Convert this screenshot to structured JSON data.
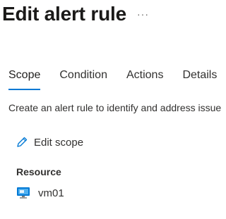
{
  "header": {
    "title": "Edit alert rule",
    "more_label": "···"
  },
  "tabs": [
    {
      "label": "Scope",
      "active": true
    },
    {
      "label": "Condition",
      "active": false
    },
    {
      "label": "Actions",
      "active": false
    },
    {
      "label": "Details",
      "active": false
    }
  ],
  "scope": {
    "description": "Create an alert rule to identify and address issue",
    "edit_scope_label": "Edit scope",
    "edit_scope_icon": "pencil-icon",
    "resource_header": "Resource",
    "resources": [
      {
        "name": "vm01",
        "icon": "virtual-machine-icon"
      }
    ]
  },
  "colors": {
    "accent": "#0078d4",
    "text": "#323130"
  }
}
